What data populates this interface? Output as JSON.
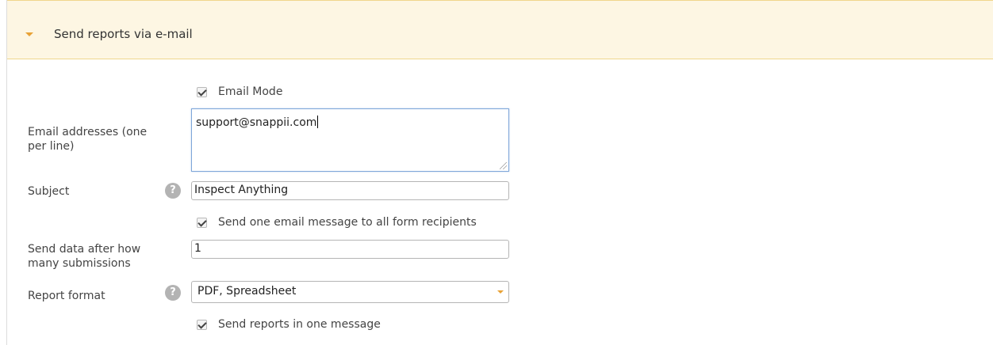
{
  "section": {
    "title": "Send reports via e-mail"
  },
  "email_mode": {
    "checked": true,
    "label": "Email Mode"
  },
  "email_addresses": {
    "label_line1": "Email addresses (one",
    "label_line2": "per line)",
    "value": "support@snappii.com"
  },
  "subject": {
    "label": "Subject",
    "help_icon": "question-circle-icon",
    "value": "Inspect Anything"
  },
  "send_one_message_all": {
    "checked": true,
    "label": "Send one email message to all form recipients"
  },
  "send_after": {
    "label_line1": "Send data after how",
    "label_line2": "many submissions",
    "value": "1"
  },
  "report_format": {
    "label": "Report format",
    "help_icon": "question-circle-icon",
    "value": "PDF, Spreadsheet"
  },
  "send_reports_one_message": {
    "checked": true,
    "label": "Send reports in one message"
  },
  "colors": {
    "header_bg": "#fdf6e3",
    "header_border": "#f0d68c",
    "accent_arrow": "#e8a236",
    "focus_border": "#7fa7d9"
  }
}
